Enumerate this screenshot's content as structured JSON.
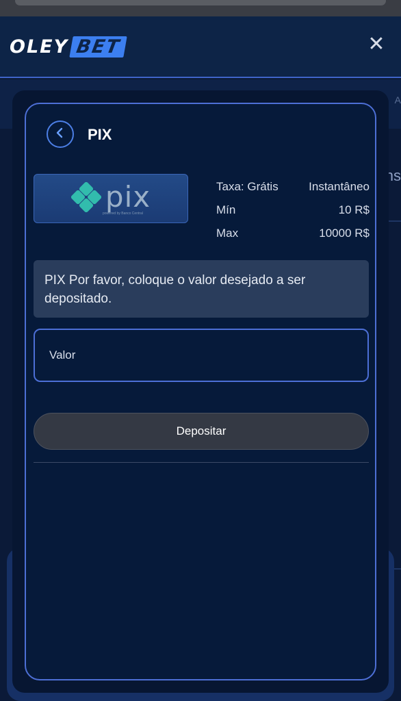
{
  "header": {
    "logo_part1": "OLEY",
    "logo_part2": "BET",
    "close_glyph": "✕"
  },
  "background": {
    "right_text": "A",
    "right_text2": "ns"
  },
  "modal": {
    "title": "PIX",
    "back_glyph": "‹",
    "pix_logo_text": "pix",
    "pix_logo_sub": "powered by Banco Central",
    "info": {
      "fee_label": "Taxa: Grátis",
      "speed": "Instantâneo",
      "min_label": "Mín",
      "min_value": "10 R$",
      "max_label": "Max",
      "max_value": "10000 R$"
    },
    "notice": "PIX Por favor, coloque o valor desejado a ser depositado.",
    "amount_placeholder": "Valor",
    "deposit_label": "Depositar"
  },
  "colors": {
    "accent": "#4d6fd6",
    "brand_blue": "#3c7ff0",
    "pix_teal": "#32bcad"
  },
  "icons": [
    "close-icon",
    "chevron-left-icon",
    "pix-logo-icon"
  ]
}
